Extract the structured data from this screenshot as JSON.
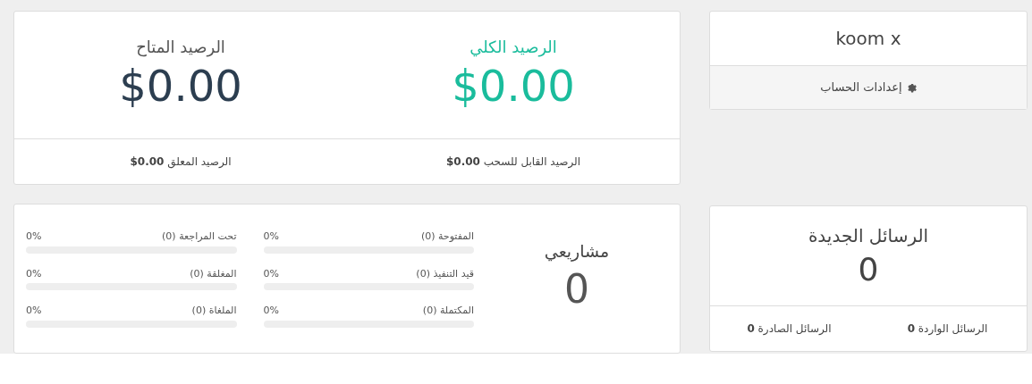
{
  "profile": {
    "name": "koom x",
    "settings_link": "إعدادات الحساب"
  },
  "balance": {
    "items": [
      {
        "title": "الرصيد الكلي",
        "amount": "$0.00",
        "kind": "total"
      },
      {
        "title": "الرصيد المتاح",
        "amount": "$0.00",
        "kind": "available"
      }
    ],
    "footer": [
      "الرصيد القابل للسحب **$0.00**",
      "الرصيد المعلق **$0.00**"
    ]
  },
  "messages": {
    "title": "الرسائل الجديدة",
    "count": "0",
    "footer": [
      "الرسائل الواردة **0**",
      "الرسائل الصادرة **0**"
    ]
  },
  "projects": {
    "title": "مشاريعي",
    "count": "0",
    "columns": [
      [
        {
          "label": "المفتوحة (0)",
          "percent": "0%",
          "level": 0
        },
        {
          "label": "قيد التنفيذ (0)",
          "percent": "0%",
          "level": 0
        },
        {
          "label": "المكتملة (0)",
          "percent": "0%",
          "level": 0
        }
      ],
      [
        {
          "label": "تحت المراجعة (0)",
          "percent": "0%",
          "level": 0
        },
        {
          "label": "المغلقة (0)",
          "percent": "0%",
          "level": 0
        },
        {
          "label": "الملغاة (0)",
          "percent": "0%",
          "level": 0
        }
      ]
    ]
  }
}
